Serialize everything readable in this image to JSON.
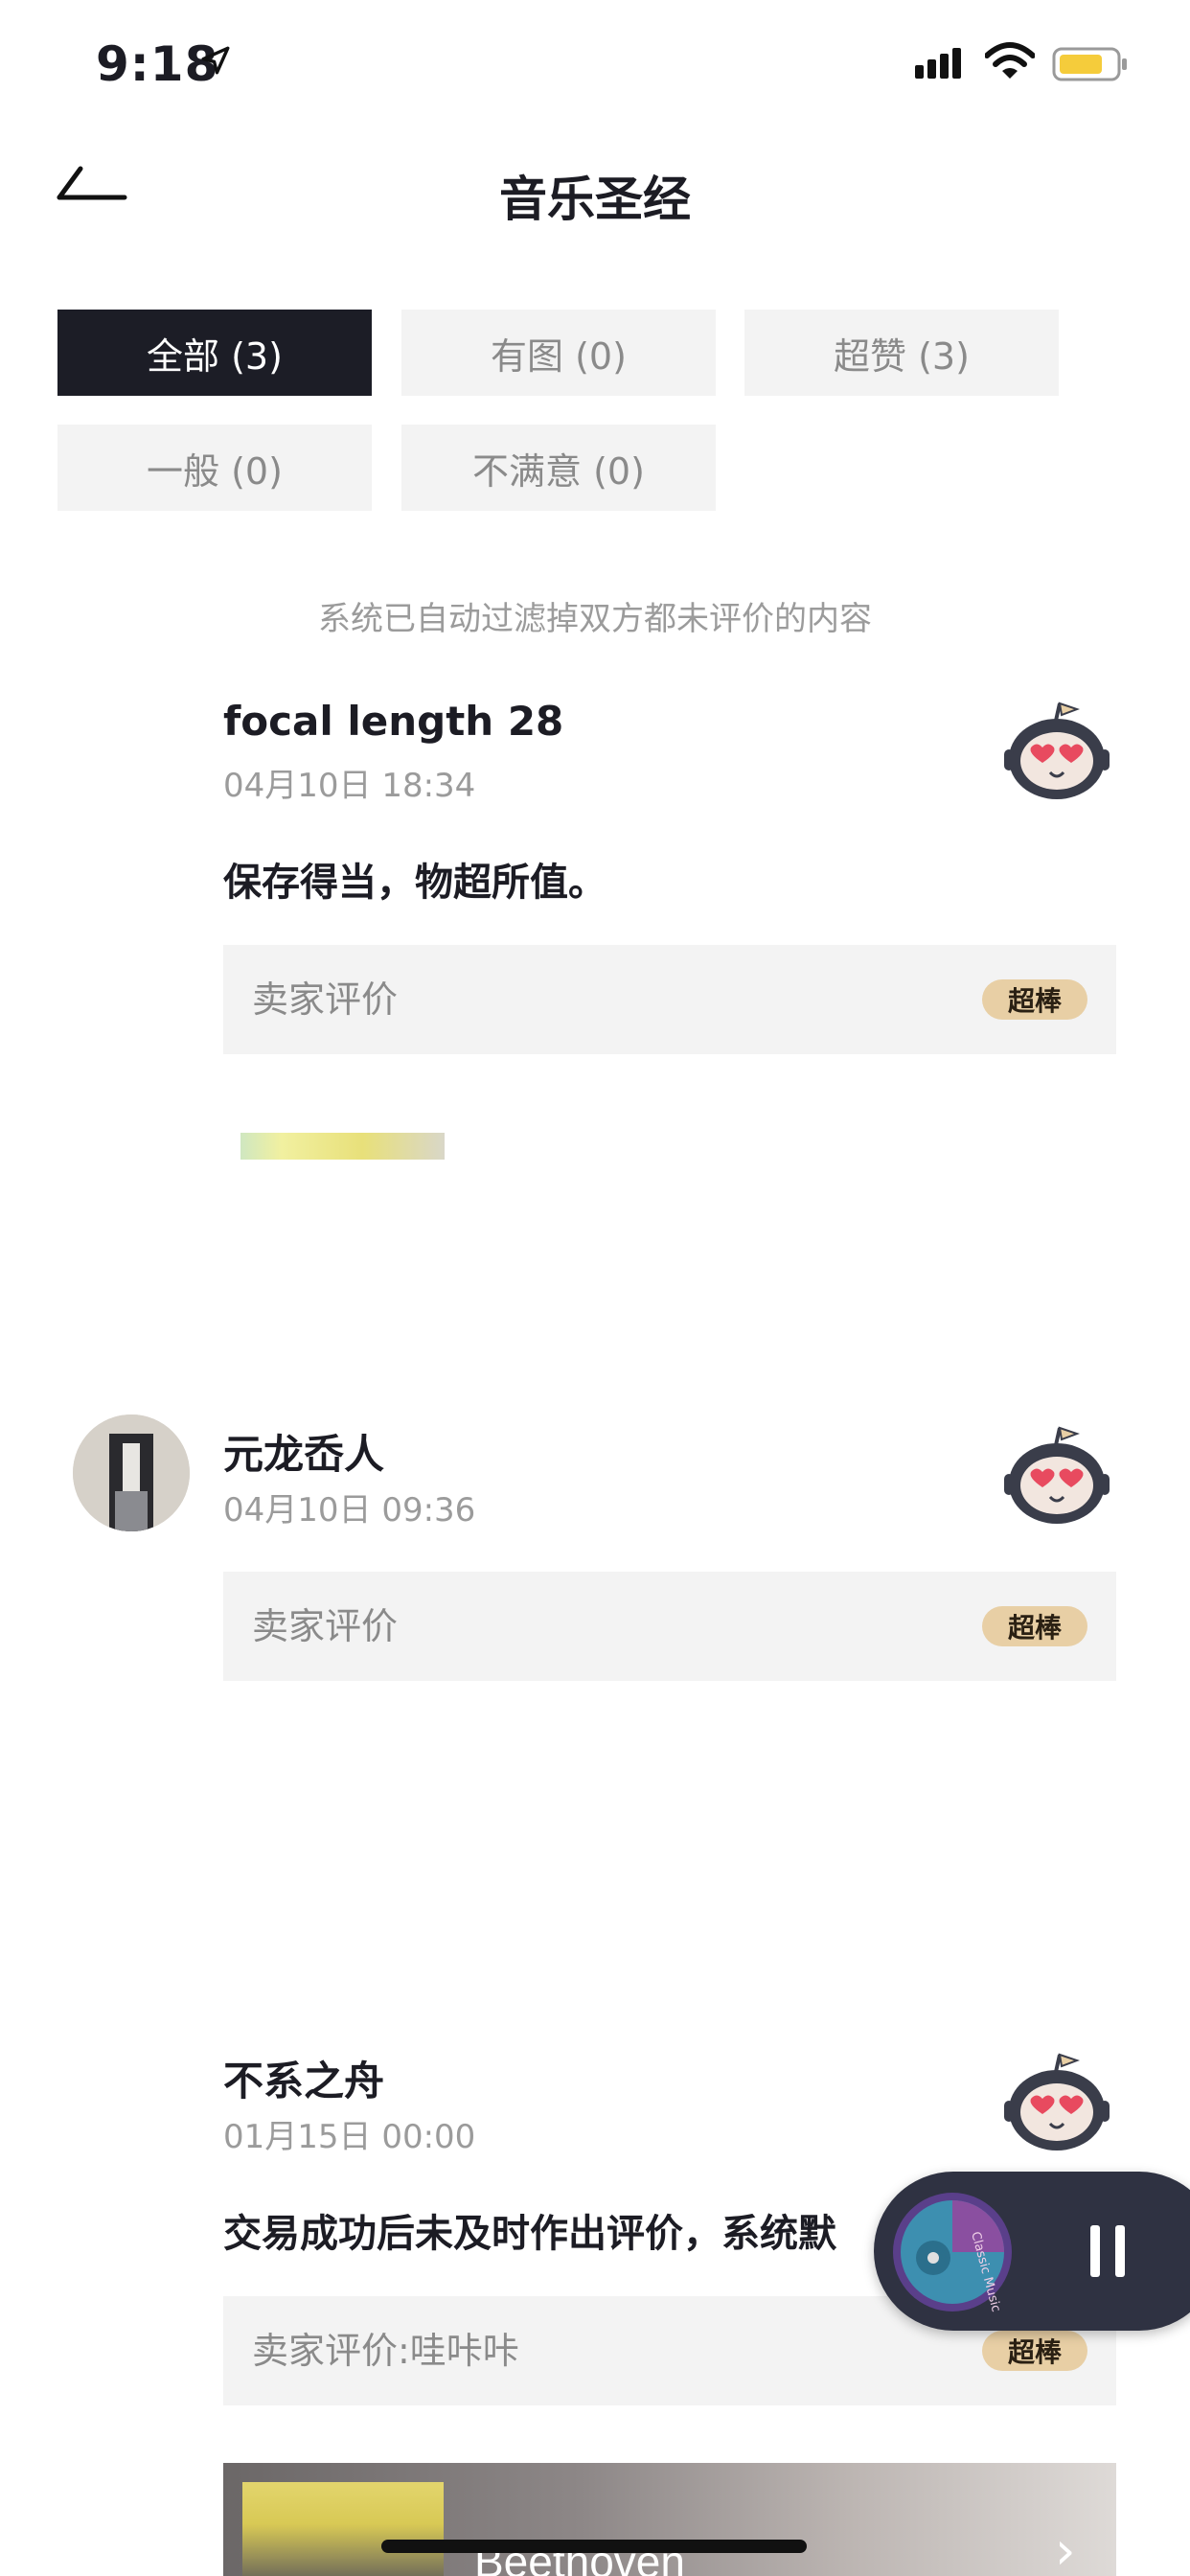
{
  "status_bar": {
    "time": "9:18"
  },
  "nav": {
    "title": "音乐圣经"
  },
  "tabs": [
    {
      "label": "全部 (3)",
      "active": true
    },
    {
      "label": "有图 (0)",
      "active": false
    },
    {
      "label": "超赞 (3)",
      "active": false
    },
    {
      "label": "一般 (0)",
      "active": false
    },
    {
      "label": "不满意 (0)",
      "active": false
    }
  ],
  "notice": "系统已自动过滤掉双方都未评价的内容",
  "reviews": [
    {
      "username": "focal length 28",
      "date": "04月10日 18:34",
      "comment": "保存得当，物超所值。",
      "seller_label": "卖家评价",
      "badge": "超棒"
    },
    {
      "username": "元龙岙人",
      "date": "04月10日 09:36",
      "seller_label": "卖家评价",
      "badge": "超棒"
    },
    {
      "username": "不系之舟",
      "date": "01月15日 00:00",
      "comment": "交易成功后未及时作出评价，系统默",
      "seller_label": "卖家评价:哇咔咔",
      "badge": "超棒",
      "album_title": "Beethoven"
    }
  ],
  "player": {
    "disc_text": "Classic Music",
    "state": "playing"
  },
  "colors": {
    "active_tab": "#1c1d26",
    "badge": "#e8cfa5",
    "player_bg": "#2f3242"
  }
}
